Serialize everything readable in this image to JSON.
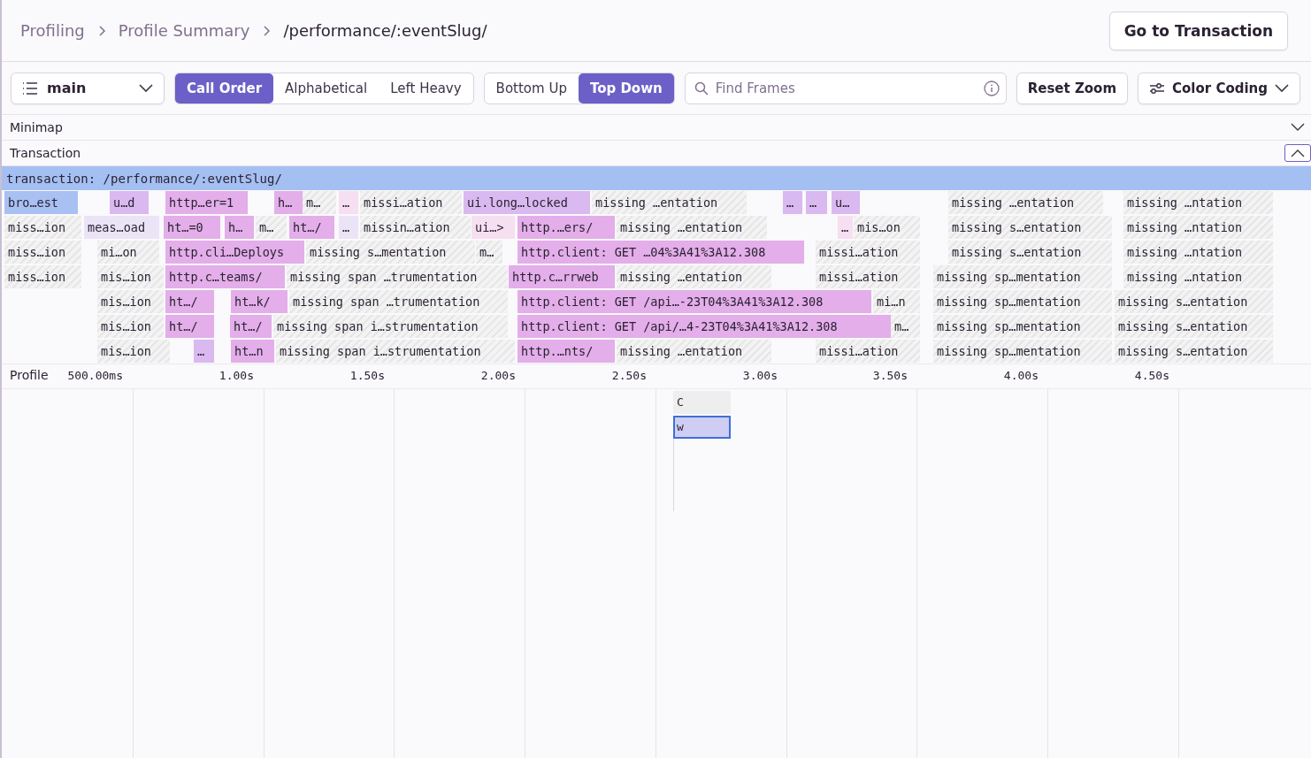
{
  "breadcrumbs": [
    "Profiling",
    "Profile Summary",
    "/performance/:eventSlug/"
  ],
  "go_button": "Go to Transaction",
  "thread_select": {
    "value": "main"
  },
  "view_options": [
    {
      "label": "Call Order",
      "selected": true
    },
    {
      "label": "Alphabetical",
      "selected": false
    },
    {
      "label": "Left Heavy",
      "selected": false
    }
  ],
  "direction_options": [
    {
      "label": "Bottom Up",
      "selected": false
    },
    {
      "label": "Top Down",
      "selected": true
    }
  ],
  "search": {
    "placeholder": "Find Frames"
  },
  "reset_zoom": "Reset Zoom",
  "color_coding": "Color Coding",
  "sections": [
    {
      "label": "Minimap",
      "expanded": false
    },
    {
      "label": "Transaction",
      "expanded": true
    }
  ],
  "transaction_bar": "transaction: /performance/:eventSlug/",
  "frame_rows": [
    [
      {
        "label": "bro…est",
        "kind": "browser"
      },
      {
        "label": "u…d",
        "kind": "ui"
      },
      {
        "label": "http…er=1",
        "kind": "http"
      },
      {
        "label": "h…",
        "kind": "http"
      },
      {
        "label": "m…",
        "kind": "missing"
      },
      {
        "label": "…",
        "kind": "pale"
      },
      {
        "label": "missi…ation",
        "kind": "missing"
      },
      {
        "label": "ui.long…locked",
        "kind": "ui"
      },
      {
        "label": "missing …entation",
        "kind": "missing"
      },
      {
        "label": "…",
        "kind": "ui"
      },
      {
        "label": "…",
        "kind": "ui"
      },
      {
        "label": "u…",
        "kind": "ui"
      },
      {
        "label": "missing …entation",
        "kind": "missing"
      },
      {
        "label": "missing …ntation",
        "kind": "missing"
      }
    ],
    [
      {
        "label": "miss…ion",
        "kind": "missing"
      },
      {
        "label": "meas…oad",
        "kind": "light"
      },
      {
        "label": "ht…=0",
        "kind": "http"
      },
      {
        "label": "h…",
        "kind": "http"
      },
      {
        "label": "m…",
        "kind": "missing"
      },
      {
        "label": "ht…/",
        "kind": "http"
      },
      {
        "label": "…",
        "kind": "light"
      },
      {
        "label": "missin…ation",
        "kind": "missing"
      },
      {
        "label": "ui…>",
        "kind": "pale"
      },
      {
        "label": "http.…ers/",
        "kind": "http"
      },
      {
        "label": "missing …entation",
        "kind": "missing"
      },
      {
        "label": "…",
        "kind": "pale"
      },
      {
        "label": "mis…on",
        "kind": "missing"
      },
      {
        "label": "missing s…entation",
        "kind": "missing"
      },
      {
        "label": "missing …ntation",
        "kind": "missing"
      }
    ],
    [
      {
        "label": "miss…ion",
        "kind": "missing"
      },
      {
        "label": "mi…on",
        "kind": "missing"
      },
      {
        "label": "http.cli…Deploys",
        "kind": "http"
      },
      {
        "label": "missing s…mentation",
        "kind": "missing"
      },
      {
        "label": "m…",
        "kind": "missing"
      },
      {
        "label": "http.client: GET …04%3A41%3A12.308",
        "kind": "http"
      },
      {
        "label": "missi…ation",
        "kind": "missing"
      },
      {
        "label": "missing s…entation",
        "kind": "missing"
      },
      {
        "label": "missing …ntation",
        "kind": "missing"
      }
    ],
    [
      {
        "label": "miss…ion",
        "kind": "missing"
      },
      {
        "label": "mis…ion",
        "kind": "missing"
      },
      {
        "label": "http.c…teams/",
        "kind": "http"
      },
      {
        "label": "missing span …trumentation",
        "kind": "missing"
      },
      {
        "label": "http.c…rrweb",
        "kind": "http"
      },
      {
        "label": "missing …entation",
        "kind": "missing"
      },
      {
        "label": "missi…ation",
        "kind": "missing"
      },
      {
        "label": "missing sp…mentation",
        "kind": "missing"
      },
      {
        "label": "missing …ntation",
        "kind": "missing"
      }
    ],
    [
      {
        "label": "mis…ion",
        "kind": "missing"
      },
      {
        "label": "ht…/",
        "kind": "http"
      },
      {
        "label": "ht…k/",
        "kind": "http"
      },
      {
        "label": "missing span …trumentation",
        "kind": "missing"
      },
      {
        "label": "http.client: GET /api…-23T04%3A41%3A12.308",
        "kind": "http"
      },
      {
        "label": "mi…n",
        "kind": "missing"
      },
      {
        "label": "missing sp…mentation",
        "kind": "missing"
      },
      {
        "label": "missing s…entation",
        "kind": "missing"
      }
    ],
    [
      {
        "label": "mis…ion",
        "kind": "missing"
      },
      {
        "label": "ht…/",
        "kind": "http"
      },
      {
        "label": "ht…/",
        "kind": "http"
      },
      {
        "label": "missing span i…strumentation",
        "kind": "missing"
      },
      {
        "label": "http.client: GET /api/…4-23T04%3A41%3A12.308",
        "kind": "http"
      },
      {
        "label": "m…",
        "kind": "missing"
      },
      {
        "label": "missing sp…mentation",
        "kind": "missing"
      },
      {
        "label": "missing s…entation",
        "kind": "missing"
      }
    ],
    [
      {
        "label": "mis…ion",
        "kind": "missing"
      },
      {
        "label": "…",
        "kind": "ui"
      },
      {
        "label": "ht…n",
        "kind": "http"
      },
      {
        "label": "missing span i…strumentation",
        "kind": "missing"
      },
      {
        "label": "http.…nts/",
        "kind": "http"
      },
      {
        "label": "missing …entation",
        "kind": "missing"
      },
      {
        "label": "missi…ation",
        "kind": "missing"
      },
      {
        "label": "missing sp…mentation",
        "kind": "missing"
      },
      {
        "label": "missing s…entation",
        "kind": "missing"
      }
    ]
  ],
  "profile_label": "Profile",
  "axis_ticks": [
    "500.00ms",
    "1.00s",
    "1.50s",
    "2.00s",
    "2.50s",
    "3.00s",
    "3.50s",
    "4.00s",
    "4.50s"
  ],
  "profile_frames": [
    {
      "label": "C",
      "selected": false
    },
    {
      "label": "w",
      "selected": true
    }
  ]
}
